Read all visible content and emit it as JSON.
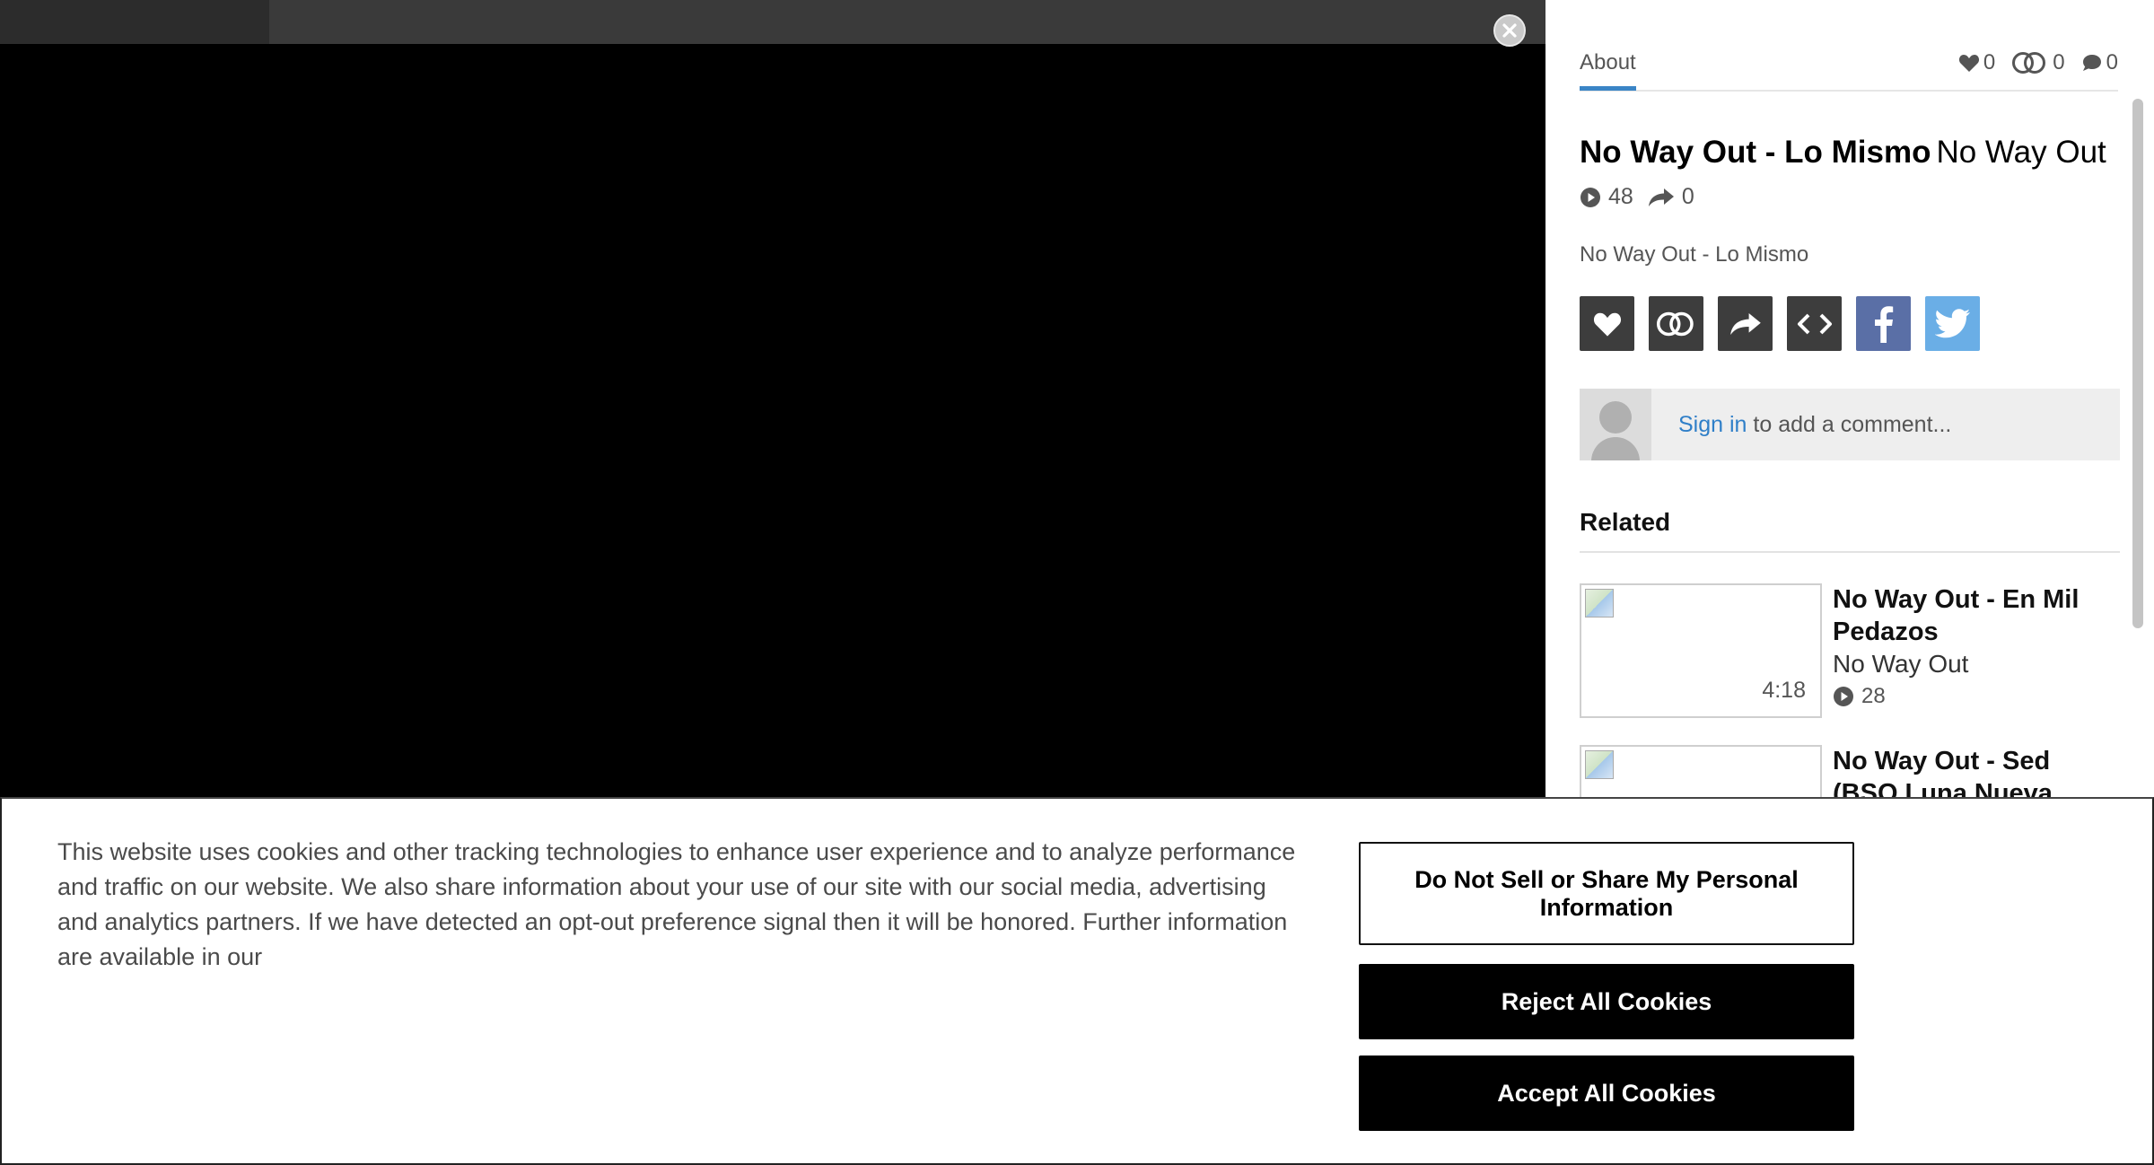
{
  "player": {
    "close_icon": "close-circle-icon"
  },
  "sidebar": {
    "tab_about": "About",
    "stats": {
      "likes": "0",
      "reposts": "0",
      "comments": "0"
    },
    "track": {
      "title": "No Way Out - Lo Mismo",
      "artist": "No Way Out",
      "plays": "48",
      "shares": "0",
      "description": "No Way Out - Lo Mismo"
    },
    "actions": [
      {
        "icon": "heart-icon",
        "color": "#3d3d3d"
      },
      {
        "icon": "repost-rings-icon",
        "color": "#3d3d3d"
      },
      {
        "icon": "share-arrow-icon",
        "color": "#3d3d3d"
      },
      {
        "icon": "embed-code-icon",
        "color": "#3d3d3d"
      },
      {
        "icon": "facebook-icon",
        "color": "#5a6fa6"
      },
      {
        "icon": "twitter-icon",
        "color": "#6aaee6"
      }
    ],
    "comment": {
      "signin_link": "Sign in",
      "prompt": "to add a comment..."
    },
    "related_heading": "Related",
    "related": [
      {
        "title": "No Way Out - En Mil Pedazos",
        "artist": "No Way Out",
        "duration": "4:18",
        "plays": "28"
      },
      {
        "title": "No Way Out - Sed (BSO Luna Nueva",
        "artist": "",
        "duration": "",
        "plays": ""
      }
    ]
  },
  "cookie": {
    "text": "This website uses cookies and other tracking technologies to enhance user experience and to analyze performance and traffic on our website. We also share information about your use of our site with our social media, advertising and analytics partners. If we have detected an opt-out preference signal then it will be honored. Further information are available in our",
    "btn_dns": "Do Not Sell or Share My Personal Information",
    "btn_reject": "Reject All Cookies",
    "btn_accept": "Accept All Cookies"
  },
  "colors": {
    "accent_blue": "#3a85c6",
    "link_blue": "#2f7fc8",
    "facebook": "#5a6fa6",
    "twitter": "#6aaee6"
  }
}
